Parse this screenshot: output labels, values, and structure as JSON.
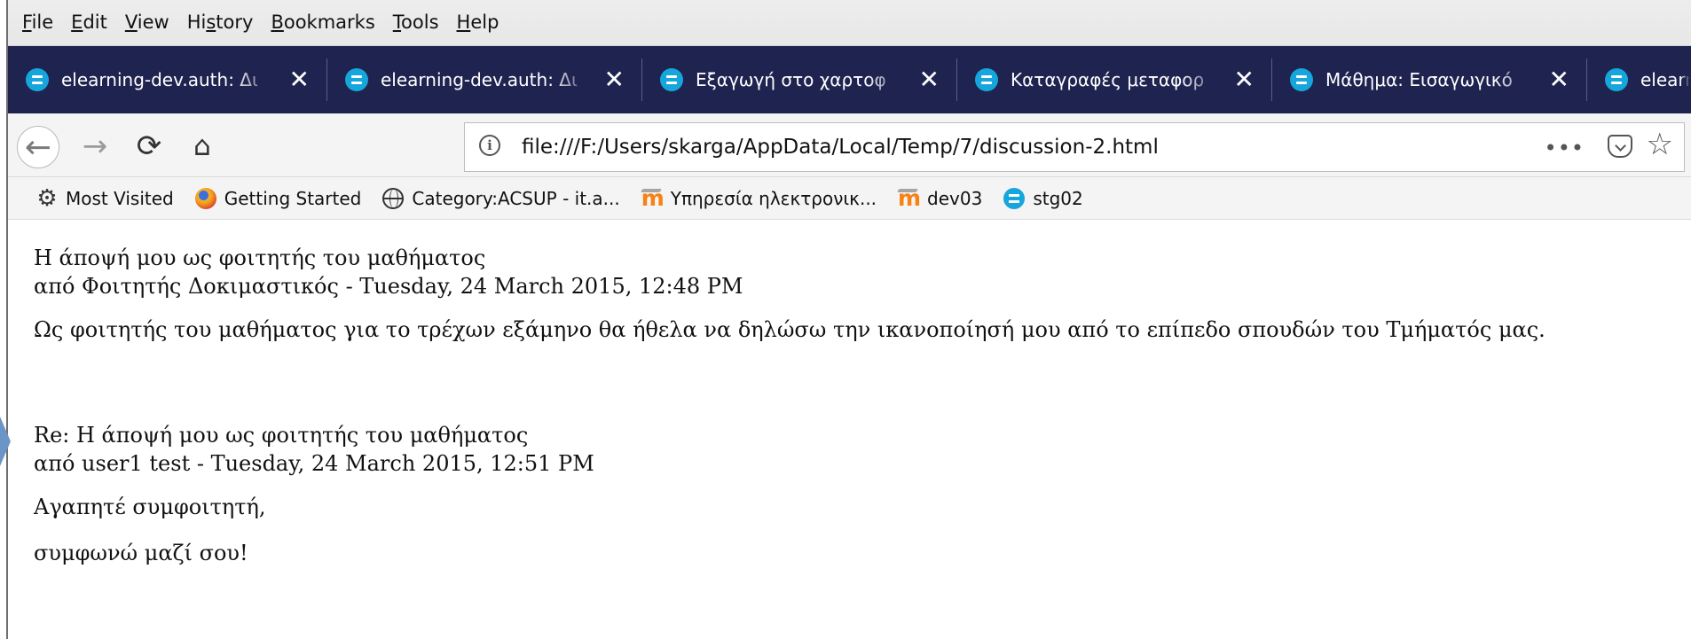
{
  "browser": {
    "menu": [
      {
        "label": "File",
        "access_key": "F"
      },
      {
        "label": "Edit",
        "access_key": "E"
      },
      {
        "label": "View",
        "access_key": "V"
      },
      {
        "label": "History",
        "access_key": "s"
      },
      {
        "label": "Bookmarks",
        "access_key": "B"
      },
      {
        "label": "Tools",
        "access_key": "T"
      },
      {
        "label": "Help",
        "access_key": "H"
      }
    ],
    "tabs": [
      {
        "title": "elearning-dev.auth: Δι",
        "close": "✕"
      },
      {
        "title": "elearning-dev.auth: Δι",
        "close": "✕"
      },
      {
        "title": "Εξαγωγή στο χαρτοφ",
        "close": "✕"
      },
      {
        "title": "Καταγραφές μεταφορ",
        "close": "✕"
      },
      {
        "title": "Μάθημα: Εισαγωγικό",
        "close": "✕"
      },
      {
        "title": "elearn",
        "close": ""
      }
    ],
    "navigation": {
      "url": "file:///F:/Users/skarga/AppData/Local/Temp/7/discussion-2.html",
      "info_icon": "info-icon",
      "back_icon": "back-arrow-icon",
      "forward_icon": "forward-arrow-icon",
      "reload_icon": "reload-icon",
      "home_icon": "home-icon",
      "page_actions": "•••",
      "pocket_icon": "pocket-icon",
      "star_icon": "star-icon"
    },
    "bookmarks": [
      {
        "label": "Most Visited",
        "icon": "gear-icon"
      },
      {
        "label": "Getting Started",
        "icon": "firefox-icon"
      },
      {
        "label": "Category:ACSUP - it.a...",
        "icon": "globe-icon"
      },
      {
        "label": "Υπηρεσία ηλεκτρονικ...",
        "icon": "moodle-icon"
      },
      {
        "label": "dev03",
        "icon": "moodle-icon"
      },
      {
        "label": "stg02",
        "icon": "moodle-circle-icon"
      }
    ]
  },
  "discussion": {
    "posts": [
      {
        "subject": "Η άποψή μου ως φοιτητής του μαθήματος",
        "meta": "από Φοιτητής Δοκιμαστικός - Tuesday, 24 March 2015, 12:48 PM",
        "body": "Ως φοιτητής του μαθήματος για το τρέχων εξάμηνο θα ήθελα να δηλώσω την ικανοποίησή μου από το επίπεδο σπουδών του Τμήματός μας."
      },
      {
        "subject": "Re: Η άποψή μου ως φοιτητής του μαθήματος",
        "meta": "από user1 test - Tuesday, 24 March 2015, 12:51 PM",
        "body": "Αγαπητέ συμφοιτητή,",
        "body2": "συμφωνώ μαζί σου!"
      }
    ]
  },
  "colors": {
    "tab_bar": "#1f2350",
    "tab_icon": "#16a6dc",
    "menu_bar": "#e8e8e8",
    "toolbar": "#f4f4f4",
    "accent_blue": "#6b95c6",
    "moodle_orange": "#f98012"
  }
}
